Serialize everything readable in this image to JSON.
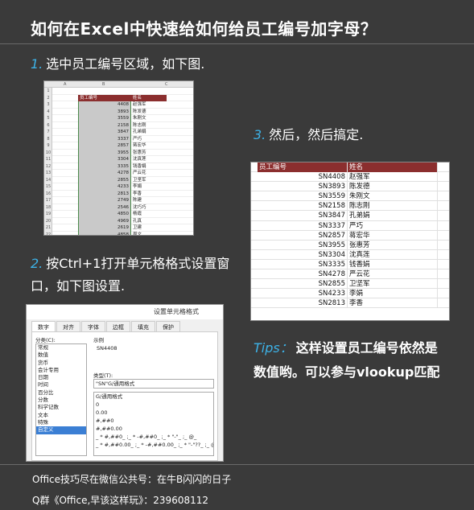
{
  "title": "如何在Excel中快速给如何给员工编号加字母？",
  "step1": {
    "num": "1.",
    "text": "选中员工编号区域，如下图."
  },
  "step2": {
    "num": "2.",
    "text": "按Ctrl+1打开单元格格式设置窗口，如下图设置."
  },
  "step3": {
    "num": "3.",
    "text": "然后，然后搞定."
  },
  "tips": {
    "label": "Tips：",
    "text": "这样设置员工编号依然是数值哟。可以参与vlookup匹配"
  },
  "footer": {
    "line1": "Office技巧尽在微信公共号：在牛B闪闪的日子",
    "line2": "Q群《Office,早该这样玩》：239608112"
  },
  "sheet1": {
    "col_headers": [
      "A",
      "B",
      "C"
    ],
    "header": [
      "员工编号",
      "姓名"
    ],
    "rows": [
      [
        "4408",
        "赵强军"
      ],
      [
        "3893",
        "陈发德"
      ],
      [
        "3559",
        "朱刚文"
      ],
      [
        "2158",
        "陈志刚"
      ],
      [
        "3847",
        "孔弟娟"
      ],
      [
        "3337",
        "严巧"
      ],
      [
        "2857",
        "蒋宏华"
      ],
      [
        "3955",
        "张惠芳"
      ],
      [
        "3304",
        "沈真莲"
      ],
      [
        "3335",
        "钱香娟"
      ],
      [
        "4278",
        "严云花"
      ],
      [
        "2855",
        "卫坚军"
      ],
      [
        "4233",
        "李娟"
      ],
      [
        "2813",
        "李香"
      ],
      [
        "2749",
        "陈建"
      ],
      [
        "2546",
        "沈巧巧"
      ],
      [
        "4850",
        "杨霞"
      ],
      [
        "4969",
        "孔真"
      ],
      [
        "2619",
        "卫建"
      ],
      [
        "4858",
        "周文"
      ]
    ],
    "row_numbers": [
      "1",
      "2",
      "3",
      "4",
      "5",
      "6",
      "7",
      "8",
      "9",
      "10",
      "11",
      "12",
      "13",
      "14",
      "15",
      "16",
      "17",
      "18",
      "19",
      "20",
      "21",
      "22"
    ]
  },
  "dialog": {
    "title": "设置单元格格式",
    "tabs": [
      "数字",
      "对齐",
      "字体",
      "边框",
      "填充",
      "保护"
    ],
    "category_label": "分类(C):",
    "categories": [
      "常规",
      "数值",
      "货币",
      "会计专用",
      "日期",
      "时间",
      "百分比",
      "分数",
      "科学记数",
      "文本",
      "特殊",
      "自定义"
    ],
    "selected_category": "自定义",
    "sample_label": "示例",
    "sample_value": "SN4408",
    "type_label": "类型(T):",
    "type_value": "\"SN\"G/通用格式",
    "formats": [
      "G/通用格式",
      "0",
      "0.00",
      "#,##0",
      "#,##0.00",
      "_ * #,##0_ ;_ * -#,##0_ ;_ * \"-\"_ ;_ @_",
      "_ * #,##0.00_ ;_ * -#,##0.00_ ;_ * \"-\"??_ ;_ @_"
    ]
  },
  "sheet3": {
    "header": [
      "员工编号",
      "姓名"
    ],
    "rows": [
      [
        "SN4408",
        "赵强军"
      ],
      [
        "SN3893",
        "陈发德"
      ],
      [
        "SN3559",
        "朱刚文"
      ],
      [
        "SN2158",
        "陈志刚"
      ],
      [
        "SN3847",
        "孔弟娟"
      ],
      [
        "SN3337",
        "严巧"
      ],
      [
        "SN2857",
        "蒋宏华"
      ],
      [
        "SN3955",
        "张惠芳"
      ],
      [
        "SN3304",
        "沈真莲"
      ],
      [
        "SN3335",
        "钱香娟"
      ],
      [
        "SN4278",
        "严云花"
      ],
      [
        "SN2855",
        "卫坚军"
      ],
      [
        "SN4233",
        "李娟"
      ],
      [
        "SN2813",
        "李香"
      ]
    ]
  }
}
